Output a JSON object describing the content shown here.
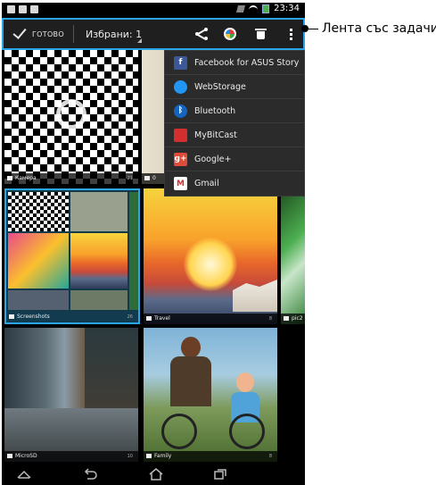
{
  "status_bar": {
    "time": "23:34"
  },
  "action_bar": {
    "done_label": "ГОТОВО",
    "selection_label": "Избрани: 1",
    "icons": [
      "share-icon",
      "cast-icon",
      "delete-icon",
      "overflow-menu-icon"
    ]
  },
  "share_menu": {
    "items": [
      {
        "label": "Facebook for ASUS Story",
        "icon": "facebook-story-icon",
        "color": "#3b5998"
      },
      {
        "label": "WebStorage",
        "icon": "webstorage-icon",
        "color": "#2196f3"
      },
      {
        "label": "Bluetooth",
        "icon": "bluetooth-icon",
        "color": "#1565c0"
      },
      {
        "label": "MyBitCast",
        "icon": "mybitcast-icon",
        "color": "#d32f2f"
      },
      {
        "label": "Google+",
        "icon": "google-plus-icon",
        "color": "#dd4b39"
      },
      {
        "label": "Gmail",
        "icon": "gmail-icon",
        "color": "#ffffff"
      }
    ]
  },
  "albums": [
    {
      "name": "Камера",
      "count": "21"
    },
    {
      "name": "0",
      "count": ""
    },
    {
      "name": "Screenshots",
      "count": "26"
    },
    {
      "name": "Travel",
      "count": "8"
    },
    {
      "name": "pic2",
      "count": ""
    },
    {
      "name": "MicroSD",
      "count": "10"
    },
    {
      "name": "Family",
      "count": "8"
    }
  ],
  "nav_bar": {
    "icons": [
      "keyboard-hide-icon",
      "back-icon",
      "home-icon",
      "recent-apps-icon"
    ]
  },
  "annotation": {
    "label": "Лента със задачи"
  },
  "colors": {
    "selection_accent": "#2aa6e8",
    "action_bar_bg": "#1f1f1f",
    "menu_bg": "#2b2b2b"
  }
}
